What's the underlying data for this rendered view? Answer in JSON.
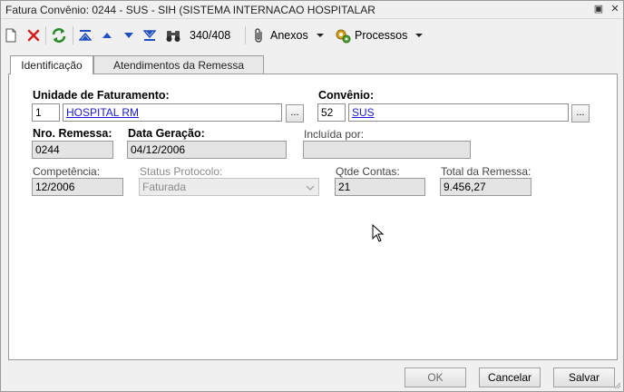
{
  "window": {
    "title": "Fatura Convênio: 0244 - SUS - SIH (SISTEMA INTERNACAO HOSPITALAR",
    "restore_glyph": "▣",
    "close_glyph": "✕"
  },
  "toolbar": {
    "record_position": "340/408",
    "attachments_label": "Anexos",
    "processes_label": "Processos"
  },
  "tabs": [
    {
      "label": "Identificação",
      "active": true
    },
    {
      "label": "Atendimentos da Remessa",
      "active": false
    }
  ],
  "form": {
    "unidade_label": "Unidade de Faturamento:",
    "unidade_code": "1",
    "unidade_name": "HOSPITAL RM",
    "convenio_label": "Convênio:",
    "convenio_code": "52",
    "convenio_name": "SUS",
    "ellipsis": "...",
    "nro_remessa_label": "Nro. Remessa:",
    "nro_remessa": "0244",
    "data_geracao_label": "Data Geração:",
    "data_geracao": "04/12/2006",
    "incluida_por_label": "Incluída por:",
    "incluida_por": "",
    "competencia_label": "Competência:",
    "competencia": "12/2006",
    "status_protocolo_label": "Status Protocolo:",
    "status_protocolo": "Faturada",
    "qtde_contas_label": "Qtde Contas:",
    "qtde_contas": "21",
    "total_remessa_label": "Total da Remessa:",
    "total_remessa": "9.456,27"
  },
  "buttons": {
    "ok": "OK",
    "cancelar": "Cancelar",
    "salvar": "Salvar"
  },
  "colors": {
    "link": "#1a1ad6",
    "delete_icon": "#d42020",
    "refresh_icon": "#2a8a2a",
    "nav_icon": "#2050c0"
  }
}
